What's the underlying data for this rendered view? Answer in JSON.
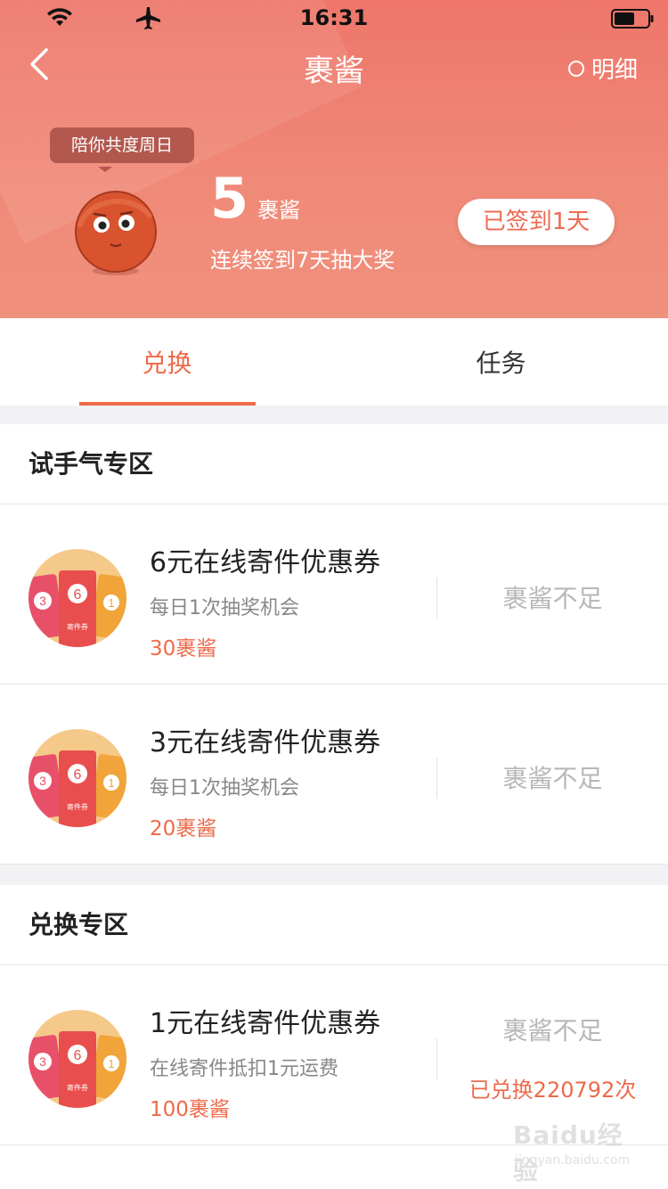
{
  "status_bar": {
    "time": "16:31"
  },
  "nav": {
    "title": "裹酱",
    "detail_label": "明细"
  },
  "header": {
    "bubble_text": "陪你共度周日",
    "points_value": "5",
    "points_unit": "裹酱",
    "streak_text": "连续签到7天抽大奖",
    "signin_label": "已签到1天"
  },
  "tabs": [
    {
      "label": "兑换",
      "active": true
    },
    {
      "label": "任务",
      "active": false
    }
  ],
  "sections": [
    {
      "title": "试手气专区",
      "items": [
        {
          "title": "6元在线寄件优惠券",
          "desc": "每日1次抽奖机会",
          "cost": "30裹酱",
          "action": "裹酱不足",
          "redeemed": ""
        },
        {
          "title": "3元在线寄件优惠券",
          "desc": "每日1次抽奖机会",
          "cost": "20裹酱",
          "action": "裹酱不足",
          "redeemed": ""
        }
      ]
    },
    {
      "title": "兑换专区",
      "items": [
        {
          "title": "1元在线寄件优惠券",
          "desc": "在线寄件抵扣1元运费",
          "cost": "100裹酱",
          "action": "裹酱不足",
          "redeemed": "已兑换220792次"
        }
      ]
    }
  ],
  "coupon_thumb": {
    "values": [
      "3",
      "6",
      "1"
    ],
    "label": "寄件券"
  },
  "watermark": {
    "main": "Baidu经验",
    "sub": "jingyan.baidu.com"
  },
  "colors": {
    "accent": "#ee6a4a",
    "header_top": "#ee766a",
    "header_bottom": "#f0917d",
    "muted": "#b7b7b7"
  }
}
